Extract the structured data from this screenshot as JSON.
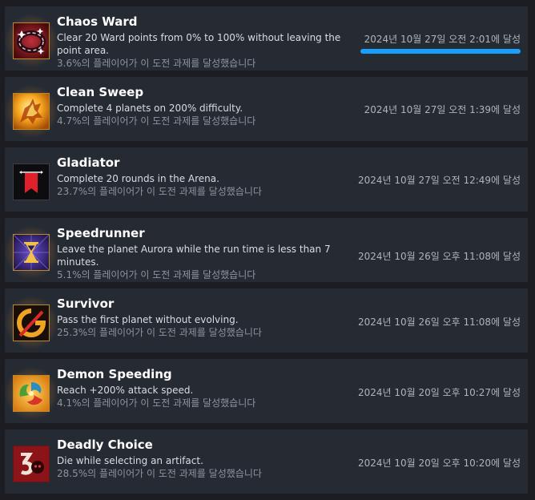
{
  "percent_suffix": "의 플레이어가 이 도전 과제를 달성했습니다",
  "achievements": [
    {
      "title": "Chaos Ward",
      "desc": "Clear 20 Ward points from 0% to 100% without leaving the point area.",
      "percent": "3.6%",
      "date": "2024년 10월 27일 오전 2:01에 달성",
      "progress_percent": 100,
      "icon": "portal-ring-icon"
    },
    {
      "title": "Clean Sweep",
      "desc": "Complete 4 planets on 200% difficulty.",
      "percent": "4.7%",
      "date": "2024년 10월 27일 오전 1:39에 달성",
      "icon": "burning-creature-icon"
    },
    {
      "title": "Gladiator",
      "desc": "Complete 20 rounds in the Arena.",
      "percent": "23.7%",
      "date": "2024년 10월 27일 오전 12:49에 달성",
      "icon": "banner-icon"
    },
    {
      "title": "Speedrunner",
      "desc": "Leave the planet Aurora while the run time is less than 7 minutes.",
      "percent": "5.1%",
      "date": "2024년 10월 26일 오후 11:08에 달성",
      "icon": "hourglass-icon"
    },
    {
      "title": "Survivor",
      "desc": "Pass the first planet without evolving.",
      "percent": "25.3%",
      "date": "2024년 10월 26일 오후 11:08에 달성",
      "icon": "no-evolve-icon"
    },
    {
      "title": "Demon Speeding",
      "desc": "Reach +200% attack speed.",
      "percent": "4.1%",
      "date": "2024년 10월 20일 오후 10:27에 달성",
      "icon": "spiral-speed-icon"
    },
    {
      "title": "Deadly Choice",
      "desc": "Die while selecting an artifact.",
      "percent": "28.5%",
      "date": "2024년 10월 20일 오후 10:20에 달성",
      "icon": "skull-three-icon"
    }
  ],
  "colors": {
    "row_bg": "#262a33",
    "page_bg": "#1b1d23",
    "progress": "#1a9fff",
    "title": "#ffffff",
    "desc": "#d9dde3",
    "muted": "#8d949e"
  }
}
